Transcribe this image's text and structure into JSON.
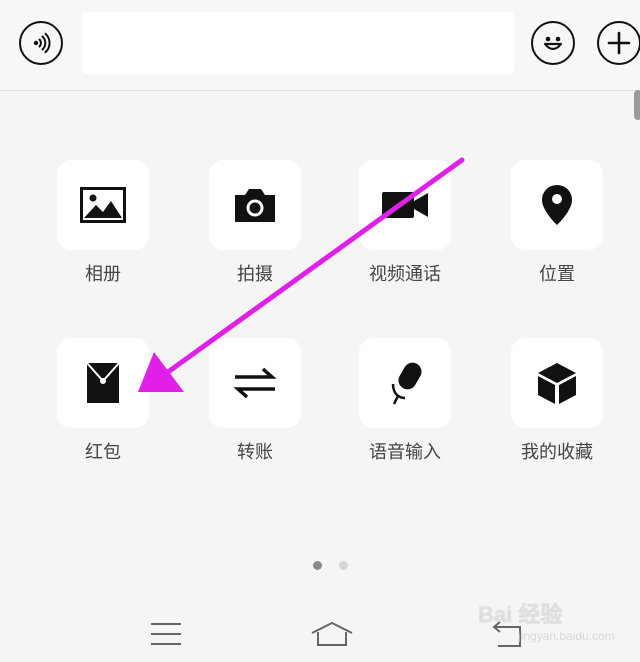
{
  "input_bar": {
    "text_value": "",
    "icons": {
      "voice": "voice-wave-icon",
      "emoji": "smiley-face-icon",
      "more": "plus-icon"
    }
  },
  "panel": {
    "tiles": [
      {
        "label": "相册",
        "icon": "image-icon"
      },
      {
        "label": "拍摄",
        "icon": "camera-icon"
      },
      {
        "label": "视频通话",
        "icon": "video-camera-icon"
      },
      {
        "label": "位置",
        "icon": "location-pin-icon"
      },
      {
        "label": "红包",
        "icon": "red-envelope-icon"
      },
      {
        "label": "转账",
        "icon": "transfer-arrows-icon"
      },
      {
        "label": "语音输入",
        "icon": "microphone-icon"
      },
      {
        "label": "我的收藏",
        "icon": "favorites-cube-icon"
      }
    ]
  },
  "pager": {
    "pages": 2,
    "current": 1
  },
  "nav": {
    "icons": [
      "menu-icon",
      "home-icon",
      "back-icon"
    ]
  },
  "annotation": {
    "color": "#e020e8",
    "target": "红包"
  },
  "watermark": {
    "text": "Bai 经验",
    "url": "jingyan.baidu.com"
  },
  "colors": {
    "background": "#f5f5f5",
    "tile_bg": "#ffffff",
    "icon": "#111111",
    "arrow": "#e020e8"
  }
}
